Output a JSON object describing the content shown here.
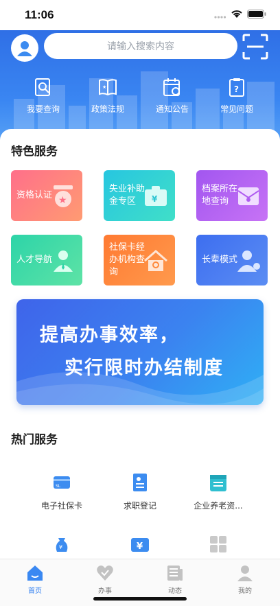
{
  "status_bar": {
    "time": "11:06"
  },
  "header": {
    "search_placeholder": "请输入搜索内容",
    "quick_links": [
      {
        "label": "我要查询",
        "icon": "search-document-icon"
      },
      {
        "label": "政策法规",
        "icon": "policy-book-icon"
      },
      {
        "label": "通知公告",
        "icon": "calendar-clock-icon"
      },
      {
        "label": "常见问题",
        "icon": "question-clipboard-icon"
      }
    ]
  },
  "featured": {
    "title": "特色服务",
    "tiles": [
      {
        "label": "资格认证",
        "icon": "medal-icon",
        "color": "#ff6f86"
      },
      {
        "label": "失业补助金专区",
        "icon": "wallet-icon",
        "color": "#2ed0d7"
      },
      {
        "label": "档案所在地查询",
        "icon": "archive-envelope-icon",
        "color": "#b05cf1"
      },
      {
        "label": "人才导航",
        "icon": "person-tie-icon",
        "color": "#34d6a0"
      },
      {
        "label": "社保卡经办机构查询",
        "icon": "house-search-icon",
        "color": "#ff8a3d"
      },
      {
        "label": "长辈模式",
        "icon": "elder-person-icon",
        "color": "#4a76f0"
      }
    ]
  },
  "banner": {
    "line1": "提高办事效率，",
    "line2": "实行限时办结制度"
  },
  "hot": {
    "title": "热门服务",
    "items": [
      {
        "label": "电子社保卡",
        "icon": "social-security-card-icon"
      },
      {
        "label": "求职登记",
        "icon": "job-registration-icon"
      },
      {
        "label": "企业养老资...",
        "icon": "pension-calendar-icon"
      }
    ],
    "more_icons": [
      "money-bag-hand-icon",
      "yuan-ticket-icon",
      "grid-apps-icon"
    ]
  },
  "tabbar": {
    "tabs": [
      {
        "label": "首页",
        "icon": "home-icon",
        "active": true
      },
      {
        "label": "办事",
        "icon": "heart-icon",
        "active": false
      },
      {
        "label": "动态",
        "icon": "news-icon",
        "active": false
      },
      {
        "label": "我的",
        "icon": "profile-icon",
        "active": false
      }
    ],
    "active_color": "#2f7ef0"
  }
}
